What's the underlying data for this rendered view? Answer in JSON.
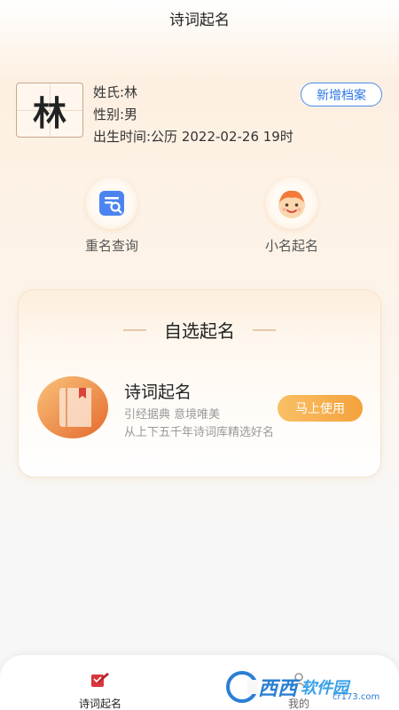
{
  "header": {
    "title": "诗词起名"
  },
  "profile": {
    "surname_char": "林",
    "surname_line": "姓氏:林",
    "gender_line": "性别:男",
    "birth_line": "出生时间:公历 2022-02-26 19时",
    "add_button": "新增档案"
  },
  "quick_actions": [
    {
      "label": "重名查询",
      "icon": "search-document-icon"
    },
    {
      "label": "小名起名",
      "icon": "baby-face-icon"
    }
  ],
  "card": {
    "title": "自选起名",
    "item": {
      "title": "诗词起名",
      "desc1": "引经据典 意境唯美",
      "desc2": "从上下五千年诗词库精选好名",
      "button": "马上使用",
      "icon": "book-icon"
    }
  },
  "tabs": [
    {
      "label": "诗词起名",
      "active": true,
      "icon": "poetry-pen-icon"
    },
    {
      "label": "我的",
      "active": false,
      "icon": "user-icon"
    }
  ],
  "watermark": {
    "text": "西西",
    "sub": "cr173.com",
    "brand": "软件园"
  },
  "colors": {
    "accent": "#f5a23c",
    "link": "#2f78e6",
    "active_tab": "#d9363e"
  }
}
